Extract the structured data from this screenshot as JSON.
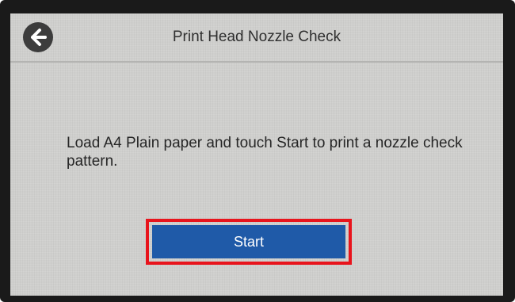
{
  "header": {
    "title": "Print Head Nozzle Check",
    "back_icon": "arrow-left-icon"
  },
  "main": {
    "message": "Load A4 Plain paper and touch Start to print a nozzle check pattern.",
    "start_label": "Start"
  },
  "colors": {
    "screen_background": "#cfcfcd",
    "start_button": "#1f5aa8",
    "highlight": "#e8141c"
  }
}
